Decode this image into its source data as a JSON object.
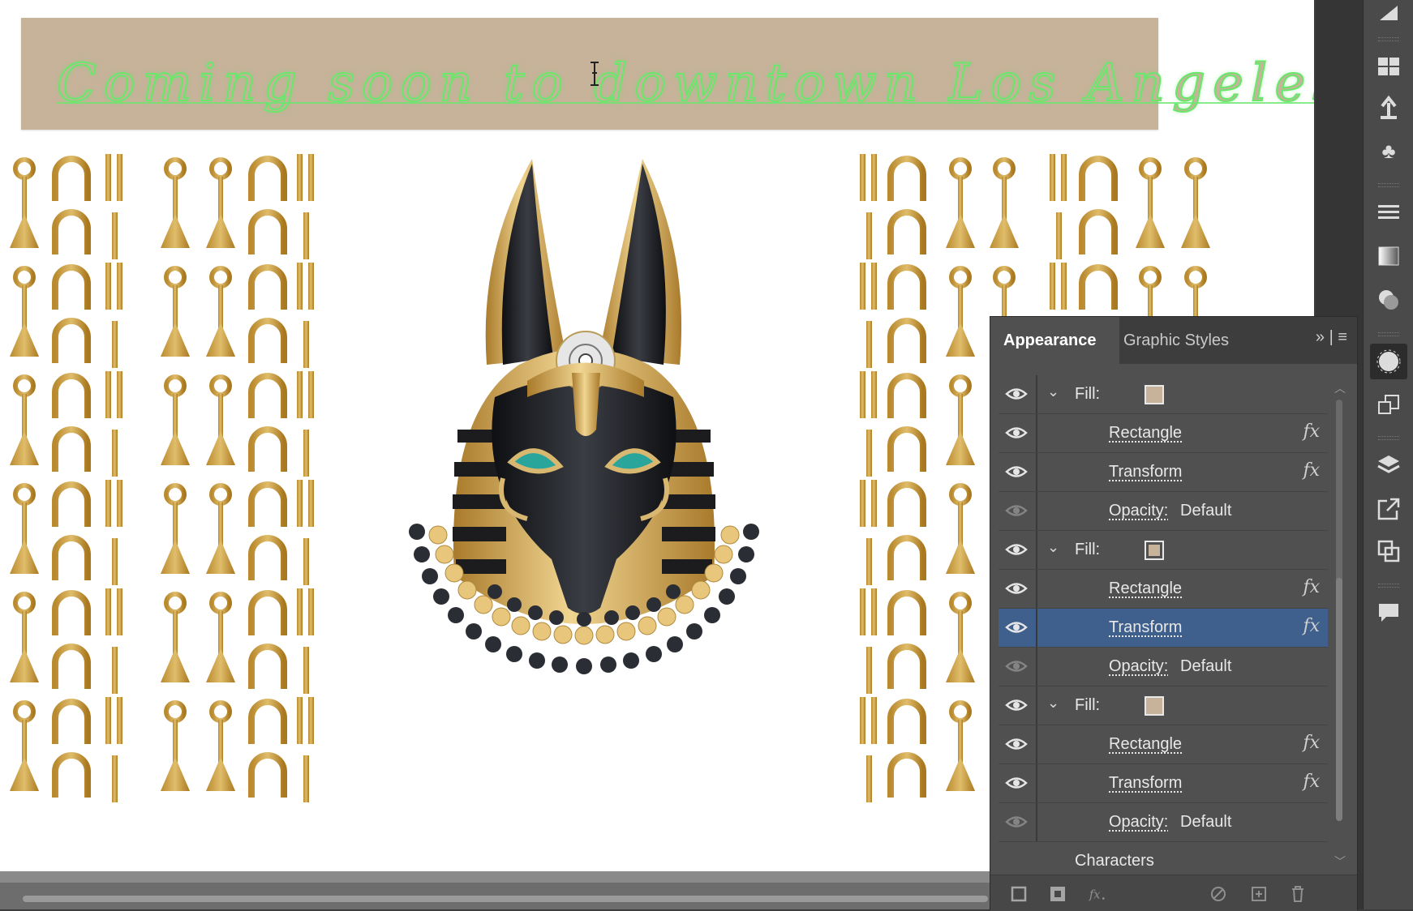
{
  "banner": {
    "text": "Coming soon to downtown Los Angeles!"
  },
  "panel": {
    "tabs": [
      {
        "label": "Appearance",
        "active": true
      },
      {
        "label": "Graphic Styles",
        "active": false
      }
    ],
    "menu_glyph": "» | ≡",
    "rows": [
      {
        "type": "fill",
        "label": "Fill:",
        "swatch": "#c6b39a"
      },
      {
        "type": "effect",
        "label": "Rectangle",
        "fx": "fx"
      },
      {
        "type": "effect",
        "label": "Transform",
        "fx": "fx"
      },
      {
        "type": "opacity",
        "label": "Opacity:",
        "value": "Default"
      },
      {
        "type": "fill",
        "label": "Fill:",
        "swatch": "#c6b39a"
      },
      {
        "type": "effect",
        "label": "Rectangle",
        "fx": "fx"
      },
      {
        "type": "effect",
        "label": "Transform",
        "fx": "fx",
        "selected": true
      },
      {
        "type": "opacity",
        "label": "Opacity:",
        "value": "Default"
      },
      {
        "type": "fill",
        "label": "Fill:",
        "swatch": "#c6b39a"
      },
      {
        "type": "effect",
        "label": "Rectangle",
        "fx": "fx"
      },
      {
        "type": "effect",
        "label": "Transform",
        "fx": "fx"
      },
      {
        "type": "opacity",
        "label": "Opacity:",
        "value": "Default"
      },
      {
        "type": "characters",
        "label": "Characters"
      }
    ]
  },
  "footer_icons": [
    "new-art-basic-icon",
    "new-fill-icon",
    "fx-icon",
    "clear-appearance-icon",
    "duplicate-item-icon",
    "delete-item-icon"
  ],
  "colors": {
    "accent_selected": "#3f5f8c",
    "banner_fill": "#c6b39a",
    "banner_text": "#69e76b",
    "gold": "#c9a04a",
    "black": "#1c1c1e",
    "teal": "#2aa59c"
  }
}
